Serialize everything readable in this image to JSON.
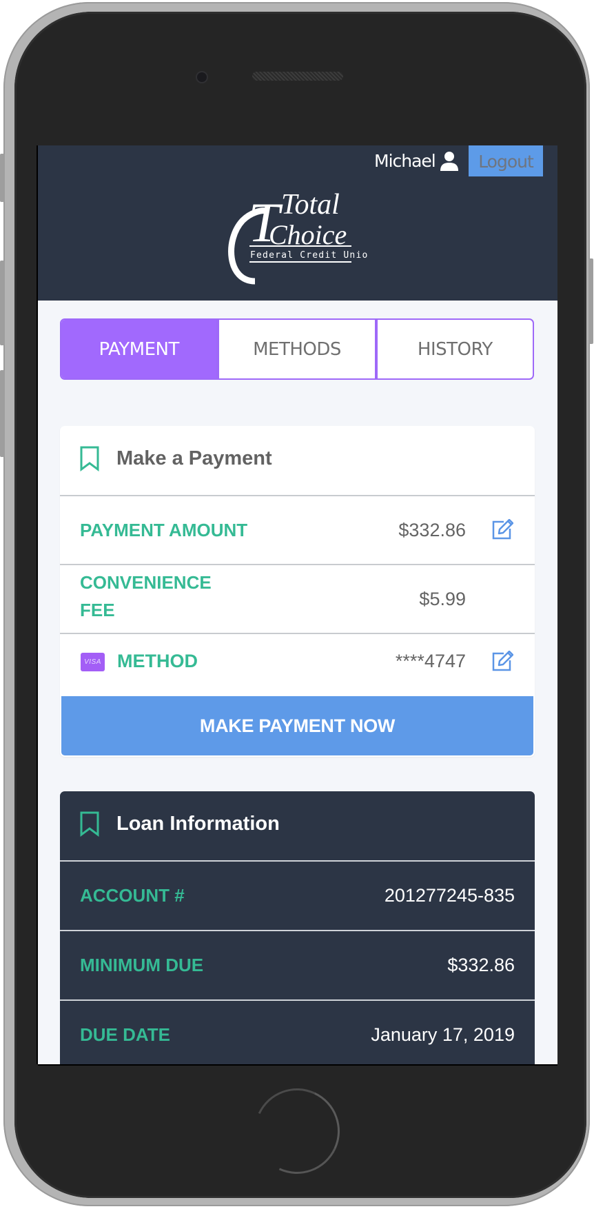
{
  "header": {
    "user_name": "Michael",
    "user_icon": "user-icon",
    "logout_label": "Logout",
    "logo": {
      "line1": "Total",
      "line2": "Choice",
      "line3": "Federal Credit Union"
    }
  },
  "tabs": [
    {
      "label": "PAYMENT",
      "active": true
    },
    {
      "label": "METHODS",
      "active": false
    },
    {
      "label": "HISTORY",
      "active": false
    }
  ],
  "payment_card": {
    "icon": "bookmark-icon",
    "title": "Make a Payment",
    "rows": [
      {
        "label": "PAYMENT AMOUNT",
        "value": "$332.86",
        "editable": true
      },
      {
        "label": "CONVENIENCE FEE",
        "label_line1": "CONVENIENCE",
        "label_line2": "FEE",
        "value": "$5.99",
        "editable": false
      },
      {
        "label": "METHOD",
        "card_brand": "VISA",
        "value": "****4747",
        "editable": true
      }
    ],
    "button_label": "MAKE PAYMENT NOW"
  },
  "loan_card": {
    "icon": "bookmark-icon",
    "title": "Loan Information",
    "rows": [
      {
        "label": "ACCOUNT #",
        "value": "201277245-835"
      },
      {
        "label": "MINIMUM DUE",
        "value": "$332.86"
      },
      {
        "label": "DUE DATE",
        "value": "January 17, 2019"
      }
    ]
  },
  "colors": {
    "header_bg": "#2c3545",
    "accent_purple": "#a169fd",
    "accent_green": "#35ba94",
    "button_blue": "#5e9ae8",
    "page_bg": "#f4f6fa"
  }
}
